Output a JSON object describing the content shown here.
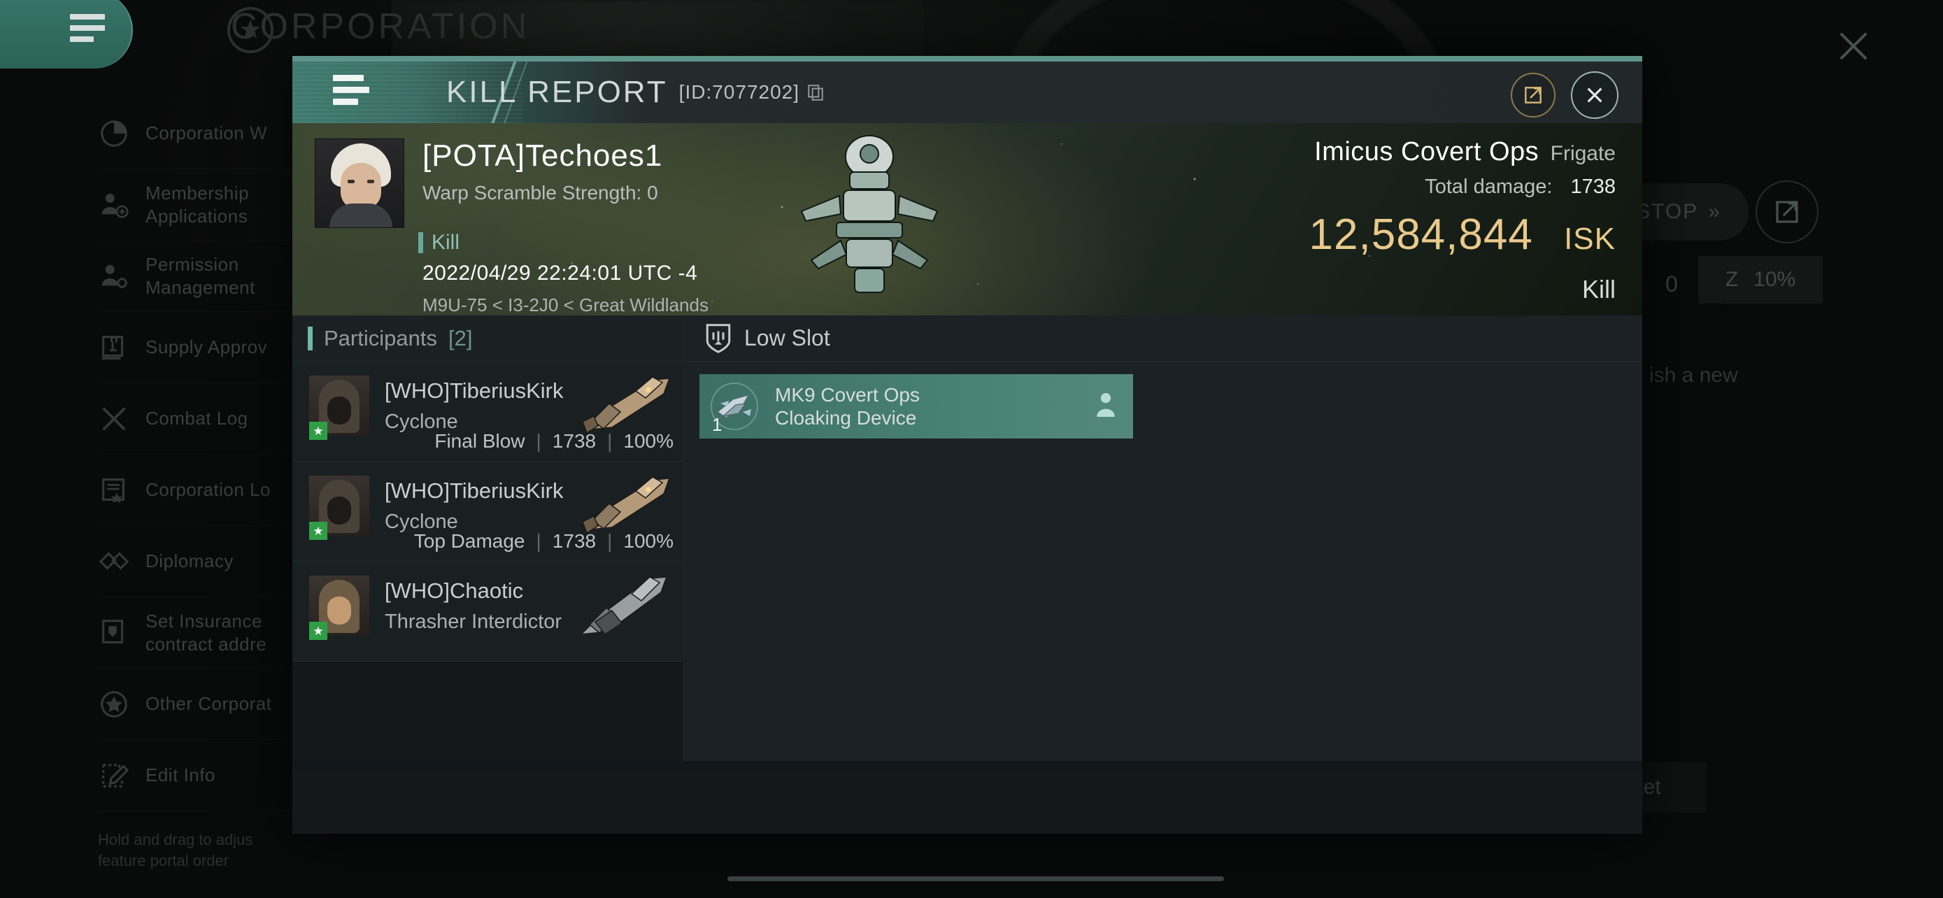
{
  "background": {
    "corp_title": "CORPORATION",
    "star_icon": "star-circle-icon",
    "hamburger_icon": "hamburger-menu-icon",
    "close_icon": "close-icon",
    "sidebar": {
      "items": [
        {
          "label": "Corporation W",
          "icon": "pie-chart-icon"
        },
        {
          "label": "Membership\nApplications",
          "icon": "user-add-icon"
        },
        {
          "label": "Permission\nManagement",
          "icon": "user-gear-icon"
        },
        {
          "label": "Supply Approv",
          "icon": "stamp-icon"
        },
        {
          "label": "Combat Log",
          "icon": "crossed-swords-icon"
        },
        {
          "label": "Corporation Lo",
          "icon": "certificate-icon"
        },
        {
          "label": "Diplomacy",
          "icon": "handshake-icon"
        },
        {
          "label": "Set Insurance\ncontract addre",
          "icon": "insurance-scroll-icon"
        },
        {
          "label": "Other Corporat",
          "icon": "star-circle-icon"
        },
        {
          "label": "Edit Info",
          "icon": "edit-pencil-icon"
        }
      ],
      "note": "Hold and drag to adjus\nfeature portal order"
    },
    "widgets": {
      "stop_label": "STOP",
      "stop_icon": "double-chevron-right-icon",
      "external_link_icon": "external-link-icon",
      "number_value": "0",
      "zoom_icon": "sleep-gear-icon",
      "zoom_value": "10%",
      "partial_text": "ish a new",
      "missions_label": "View Missions/Market"
    }
  },
  "modal": {
    "header": {
      "hamburger_icon": "hamburger-menu-icon",
      "title": "KILL REPORT",
      "id_label": "[ID:7077202]",
      "copy_icon": "copy-icon",
      "share_icon": "external-link-icon",
      "close_icon": "close-icon"
    },
    "banner": {
      "avatar_name": "pilot-avatar",
      "pilot_name": "[POTA]Techoes1",
      "warp_scramble": "Warp Scramble Strength: 0",
      "kill_tag": "Kill",
      "timestamp": "2022/04/29 22:24:01 UTC -4",
      "location": "M9U-75 < I3-2J0 < Great Wildlands",
      "ship_name": "Imicus Covert Ops",
      "ship_class": "Frigate",
      "total_damage_label": "Total damage:",
      "total_damage_value": "1738",
      "isk_value": "12,584,844",
      "isk_unit": "ISK",
      "result_label": "Kill",
      "isk_color": "#E9C98B",
      "accent_color": "#72B7A9"
    },
    "participants": {
      "section_label": "Participants",
      "count_label": "[2]",
      "rows": [
        {
          "name": "[WHO]TiberiusKirk",
          "ship": "Cyclone",
          "role": "Final Blow",
          "damage": "1738",
          "percent": "100%"
        },
        {
          "name": "[WHO]TiberiusKirk",
          "ship": "Cyclone",
          "role": "Top Damage",
          "damage": "1738",
          "percent": "100%"
        },
        {
          "name": "[WHO]Chaotic",
          "ship": "Thrasher Interdictor",
          "role": "",
          "damage": "",
          "percent": ""
        }
      ]
    },
    "low_slot": {
      "section_label": "Low Slot",
      "section_icon": "shield-slot-icon",
      "items": [
        {
          "name": "MK9 Covert Ops\nCloaking Device",
          "quantity": "1",
          "owner_icon": "person-icon"
        }
      ]
    }
  }
}
